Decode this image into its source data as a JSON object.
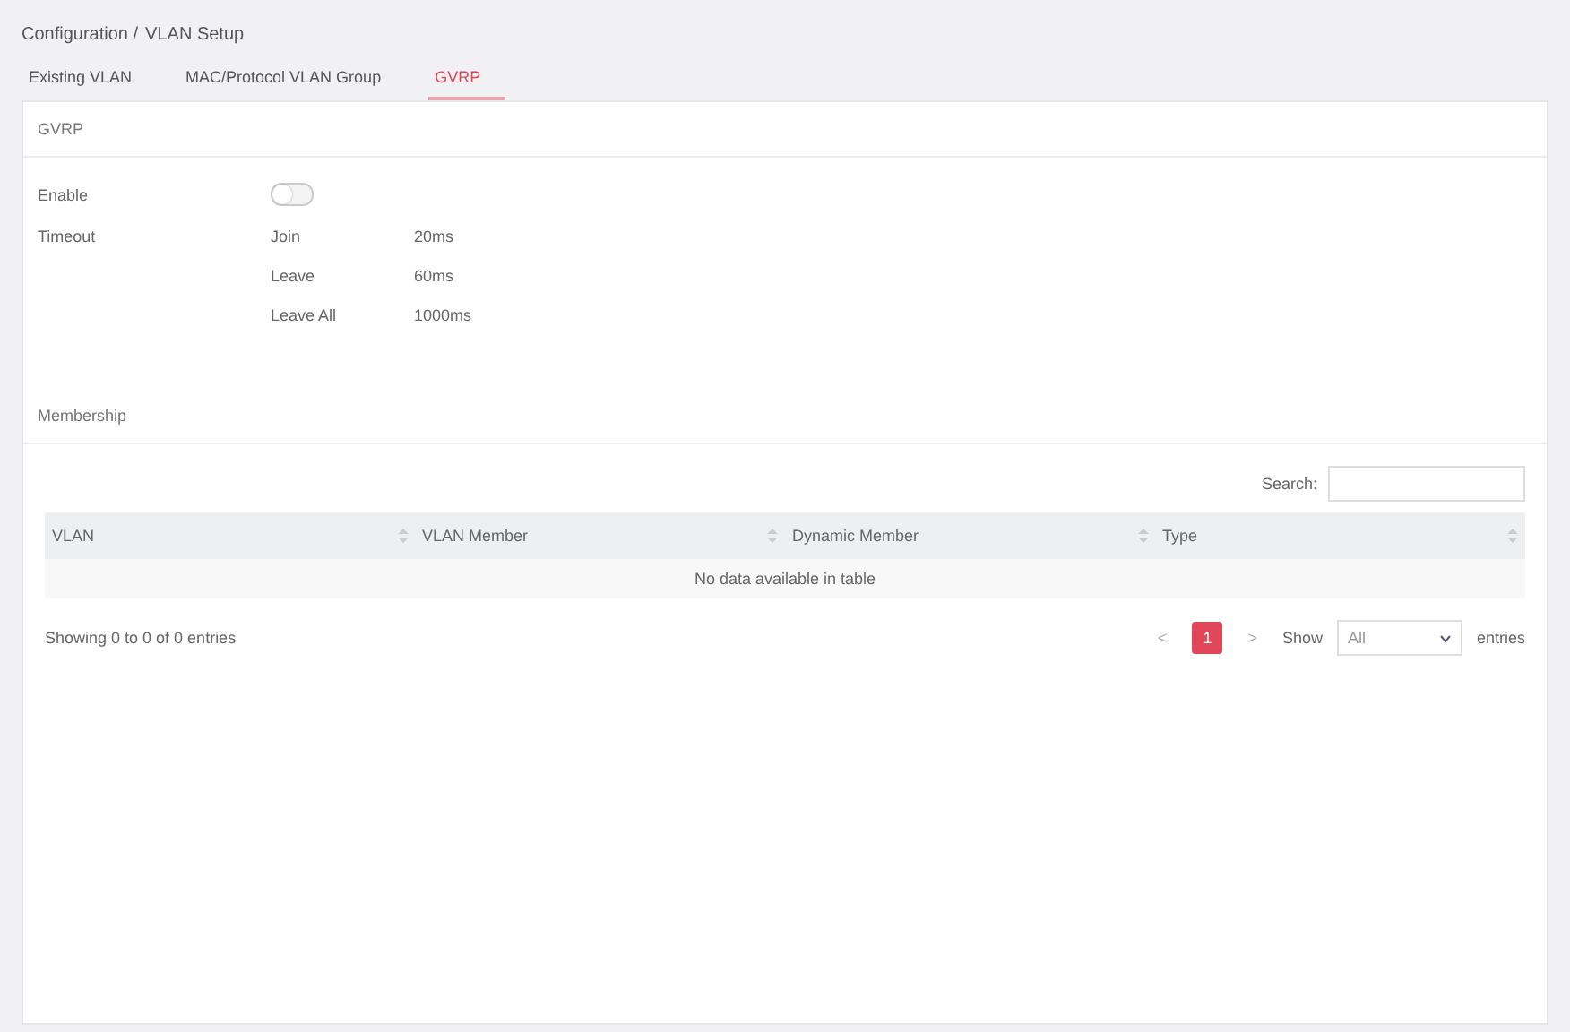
{
  "breadcrumb": {
    "parent": "Configuration /",
    "current": "VLAN Setup"
  },
  "tabs": [
    {
      "label": "Existing VLAN",
      "selected": false
    },
    {
      "label": "MAC/Protocol VLAN Group",
      "selected": false
    },
    {
      "label": "GVRP",
      "selected": true
    }
  ],
  "section_title": "GVRP",
  "enable": {
    "label": "Enable",
    "on": false
  },
  "timeout": {
    "label": "Timeout",
    "rows": [
      {
        "name": "Join",
        "value": "20ms"
      },
      {
        "name": "Leave",
        "value": "60ms"
      },
      {
        "name": "Leave All",
        "value": "1000ms"
      }
    ]
  },
  "membership": {
    "title": "Membership",
    "search_label": "Search:",
    "columns": [
      "VLAN",
      "VLAN Member",
      "Dynamic Member",
      "Type"
    ],
    "empty_text": "No data available in table",
    "info": "Showing 0 to 0 of 0 entries",
    "pagination": {
      "prev": "<",
      "pages": [
        {
          "label": "1",
          "selected": true
        }
      ],
      "next": ">"
    },
    "show_label": "Show",
    "show_value": "All",
    "entries_label": "entries"
  }
}
